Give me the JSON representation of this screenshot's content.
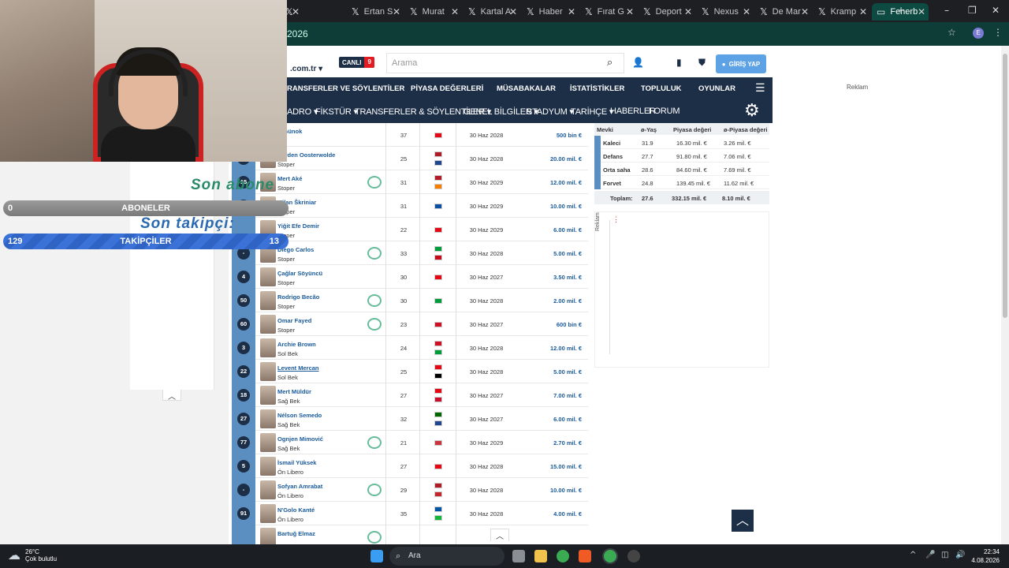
{
  "browser": {
    "tabs": [
      {
        "label": "",
        "icon": "x-icon"
      },
      {
        "label": "Ertan S",
        "icon": "x-icon"
      },
      {
        "label": "Murat",
        "icon": "x-icon"
      },
      {
        "label": "Kartal A",
        "icon": "x-icon"
      },
      {
        "label": "Haber",
        "icon": "x-icon"
      },
      {
        "label": "Fırat G",
        "icon": "x-icon"
      },
      {
        "label": "Deport",
        "icon": "x-icon"
      },
      {
        "label": "Nexus",
        "icon": "x-icon"
      },
      {
        "label": "De Mar",
        "icon": "x-icon"
      },
      {
        "label": "Kramp",
        "icon": "x-icon"
      },
      {
        "label": "Fenerb",
        "icon": "tm-icon",
        "active": true
      }
    ],
    "new_tab": "+",
    "address": "2026",
    "window_buttons": [
      "–",
      "❐",
      "✕"
    ],
    "profile": "E"
  },
  "site": {
    "domain": ".com.tr",
    "live_label": "CANLI",
    "live_count": "9",
    "search_placeholder": "Arama",
    "login_label": "GİRİŞ YAP",
    "main_nav": [
      "RANSFERLER VE SÖYLENTİLER",
      "PİYASA DEĞERLERİ",
      "MÜSABAKALAR",
      "İSTATİSTİKLER",
      "TOPLULUK",
      "OYUNLAR"
    ],
    "sub_nav": [
      "ADRO",
      "FİKSTÜR",
      "TRANSFERLER & SÖYLENTİLER",
      "GENEL BİLGİLER",
      "STADYUM",
      "TARİHÇE",
      "HABERLER",
      "FORUM"
    ],
    "reklam": "Reklam"
  },
  "squad": {
    "partial_top_pos": "eci",
    "rows": [
      {
        "num": "",
        "name": "rt Günok",
        "pos": "eci",
        "age": "37",
        "contract": "30 Haz 2028",
        "value": "500 bin €",
        "club": false,
        "flags": [
          "#e30a17"
        ]
      },
      {
        "num": "24",
        "name": "Jayden Oosterwolde",
        "pos": "Stoper",
        "age": "25",
        "contract": "30 Haz 2028",
        "value": "20.00 mil. €",
        "club": false,
        "flags": [
          "#ae1c28",
          "#21468b"
        ]
      },
      {
        "num": "15",
        "name": "Mert Aké",
        "pos": "Stoper",
        "age": "31",
        "contract": "30 Haz 2029",
        "value": "12.00 mil. €",
        "club": true,
        "flags": [
          "#ae1c28",
          "#f77f00"
        ]
      },
      {
        "num": "37",
        "name": "Milan Škriniar",
        "pos": "Stoper",
        "age": "31",
        "contract": "30 Haz 2029",
        "value": "10.00 mil. €",
        "club": false,
        "flags": [
          "#0b4ea2"
        ]
      },
      {
        "num": "",
        "name": "Yiğit Efe Demir",
        "pos": "Stoper",
        "age": "22",
        "contract": "30 Haz 2029",
        "value": "6.00 mil. €",
        "club": false,
        "flags": [
          "#e30a17"
        ]
      },
      {
        "num": "-",
        "name": "Diego Carlos",
        "pos": "Stoper",
        "age": "33",
        "contract": "30 Haz 2028",
        "value": "5.00 mil. €",
        "club": true,
        "flags": [
          "#009c3b",
          "#c60b1e"
        ]
      },
      {
        "num": "4",
        "name": "Çağlar Söyüncü",
        "pos": "Stoper",
        "age": "30",
        "contract": "30 Haz 2027",
        "value": "3.50 mil. €",
        "club": false,
        "flags": [
          "#e30a17"
        ]
      },
      {
        "num": "50",
        "name": "Rodrigo Becão",
        "pos": "Stoper",
        "age": "30",
        "contract": "30 Haz 2028",
        "value": "2.00 mil. €",
        "club": true,
        "flags": [
          "#009c3b"
        ]
      },
      {
        "num": "60",
        "name": "Omar Fayed",
        "pos": "Stoper",
        "age": "23",
        "contract": "30 Haz 2027",
        "value": "600 bin €",
        "club": true,
        "flags": [
          "#ce1126"
        ]
      },
      {
        "num": "3",
        "name": "Archie Brown",
        "pos": "Sol Bek",
        "age": "24",
        "contract": "30 Haz 2028",
        "value": "12.00 mil. €",
        "club": false,
        "flags": [
          "#ce1124",
          "#009b3a"
        ]
      },
      {
        "num": "22",
        "name": "Levent Mercan",
        "pos": "Sol Bek",
        "age": "25",
        "contract": "30 Haz 2028",
        "value": "5.00 mil. €",
        "club": false,
        "flags": [
          "#e30a17",
          "#000000"
        ]
      },
      {
        "num": "18",
        "name": "Mert Müldür",
        "pos": "Sağ Bek",
        "age": "27",
        "contract": "30 Haz 2027",
        "value": "7.00 mil. €",
        "club": false,
        "flags": [
          "#e30a17",
          "#c8102e"
        ]
      },
      {
        "num": "27",
        "name": "Nélson Semedo",
        "pos": "Sağ Bek",
        "age": "32",
        "contract": "30 Haz 2027",
        "value": "6.00 mil. €",
        "club": false,
        "flags": [
          "#006600",
          "#21468b"
        ]
      },
      {
        "num": "77",
        "name": "Ognjen Mimović",
        "pos": "Sağ Bek",
        "age": "21",
        "contract": "30 Haz 2029",
        "value": "2.70 mil. €",
        "club": true,
        "flags": [
          "#c6363c"
        ]
      },
      {
        "num": "5",
        "name": "İsmail Yüksek",
        "pos": "Ön Libero",
        "age": "27",
        "contract": "30 Haz 2028",
        "value": "15.00 mil. €",
        "club": false,
        "flags": [
          "#e30a17"
        ]
      },
      {
        "num": "-",
        "name": "Sofyan Amrabat",
        "pos": "Ön Libero",
        "age": "29",
        "contract": "30 Haz 2028",
        "value": "10.00 mil. €",
        "club": true,
        "flags": [
          "#ae1c28",
          "#c1272d"
        ]
      },
      {
        "num": "91",
        "name": "N'Golo Kanté",
        "pos": "Ön Libero",
        "age": "35",
        "contract": "30 Haz 2028",
        "value": "4.00 mil. €",
        "club": false,
        "flags": [
          "#0055a4",
          "#14b53a"
        ]
      },
      {
        "num": "",
        "name": "Bartuğ Elmaz",
        "pos": "",
        "age": "",
        "contract": "",
        "value": "",
        "club": true,
        "flags": []
      }
    ]
  },
  "positions": {
    "headers": [
      "Mevki",
      "ø-Yaş",
      "Piyasa değeri",
      "ø-Piyasa değeri"
    ],
    "rows": [
      {
        "name": "Kaleci",
        "age": "31.9",
        "value": "16.30 mil. €",
        "avg": "3.26 mil. €"
      },
      {
        "name": "Defans",
        "age": "27.7",
        "value": "91.80 mil. €",
        "avg": "7.06 mil. €"
      },
      {
        "name": "Orta saha",
        "age": "28.6",
        "value": "84.60 mil. €",
        "avg": "7.69 mil. €"
      },
      {
        "name": "Forvet",
        "age": "24.8",
        "value": "139.45 mil. €",
        "avg": "11.62 mil. €"
      }
    ],
    "total": {
      "name": "Toplam:",
      "age": "27.6",
      "value": "332.15 mil. €",
      "avg": "8.10 mil. €"
    }
  },
  "overlay": {
    "son_abone": "Son abone",
    "son_takipci": "Son takipçi:",
    "aboneler_count": "0",
    "aboneler_label": "ABONELER",
    "takipciler_count": "129",
    "takipciler_label": "TAKİPÇİLER",
    "takipciler_right": "13"
  },
  "taskbar": {
    "temp": "26°C",
    "weather": "Çok bulutlu",
    "search": "Ara",
    "time": "22:34",
    "date": "4.08.2026"
  },
  "colors": {
    "navy": "#1d2e47",
    "accent_blue": "#5b8fc2",
    "link_blue": "#1a5a9a",
    "tab_active": "#0d4a41"
  }
}
